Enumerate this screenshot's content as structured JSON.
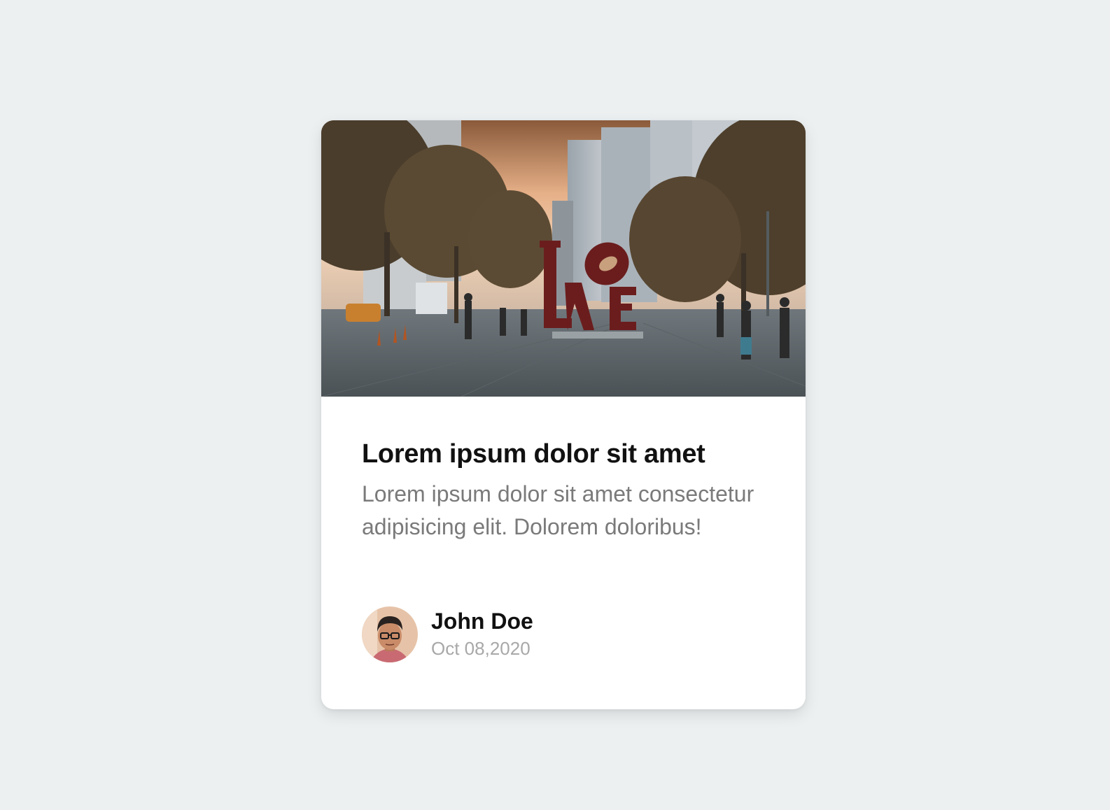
{
  "card": {
    "image_alt": "City street with LOVE sculpture",
    "title": "Lorem ipsum dolor sit amet",
    "description": "Lorem ipsum dolor sit amet consectetur adipisicing elit. Dolorem doloribus!",
    "author": {
      "name": "John Doe",
      "date": "Oct 08,2020"
    }
  },
  "colors": {
    "page_background": "#ecf0f1",
    "card_background": "#ffffff",
    "title": "#111111",
    "description": "#7a7a7a",
    "date": "#a8a8a8"
  }
}
